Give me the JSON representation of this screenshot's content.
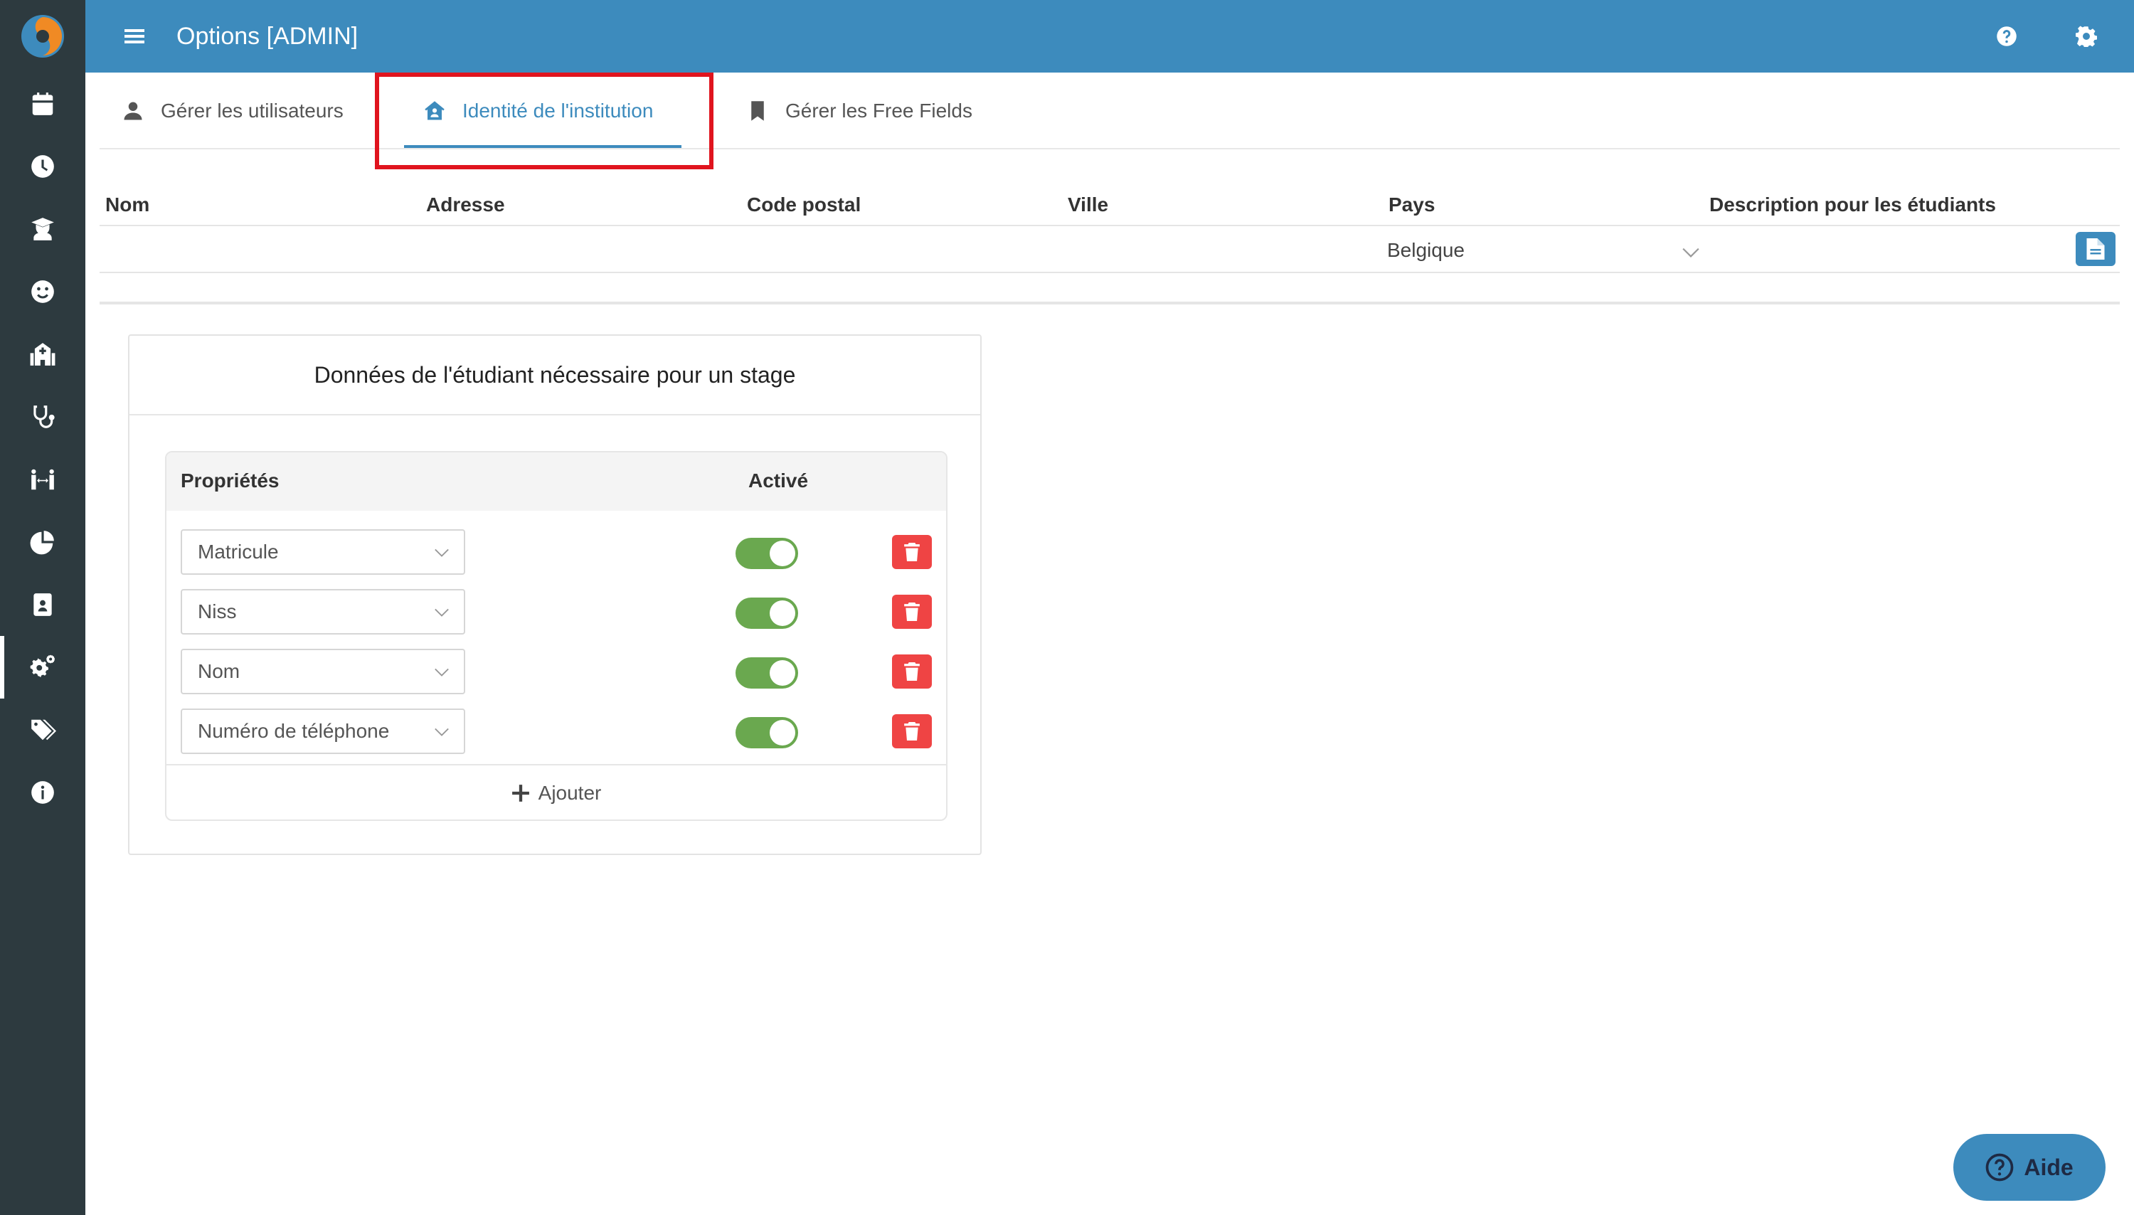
{
  "app": {
    "title": "Options [ADMIN]",
    "accent_color": "#3d8bbd",
    "sidebar_color": "#2d3a3f"
  },
  "sidebar": {
    "items": [
      {
        "icon": "calendar-icon"
      },
      {
        "icon": "clock-icon"
      },
      {
        "icon": "graduate-icon"
      },
      {
        "icon": "smile-icon"
      },
      {
        "icon": "hospital-icon"
      },
      {
        "icon": "stethoscope-icon"
      },
      {
        "icon": "people-arrows-icon"
      },
      {
        "icon": "pie-chart-icon"
      },
      {
        "icon": "id-badge-icon"
      },
      {
        "icon": "gears-icon",
        "active": true
      },
      {
        "icon": "tags-icon"
      },
      {
        "icon": "info-icon"
      }
    ]
  },
  "tabs": [
    {
      "label": "Gérer les utilisateurs",
      "icon": "user-icon"
    },
    {
      "label": "Identité de l'institution",
      "icon": "house-user-icon",
      "active": true
    },
    {
      "label": "Gérer les Free Fields",
      "icon": "bookmark-icon"
    }
  ],
  "institution_table": {
    "columns": [
      "Nom",
      "Adresse",
      "Code postal",
      "Ville",
      "Pays",
      "Description pour les étudiants"
    ],
    "row": {
      "nom": "",
      "adresse": "",
      "code_postal": "",
      "ville": "",
      "pays": "Belgique",
      "description": ""
    }
  },
  "student_data_card": {
    "title": "Données de l'étudiant nécessaire pour un stage",
    "header_properties": "Propriétés",
    "header_active": "Activé",
    "rows": [
      {
        "property": "Matricule",
        "active": true
      },
      {
        "property": "Niss",
        "active": true
      },
      {
        "property": "Nom",
        "active": true
      },
      {
        "property": "Numéro de téléphone",
        "active": true
      }
    ],
    "add_label": "Ajouter"
  },
  "help_button": {
    "label": "Aide"
  }
}
